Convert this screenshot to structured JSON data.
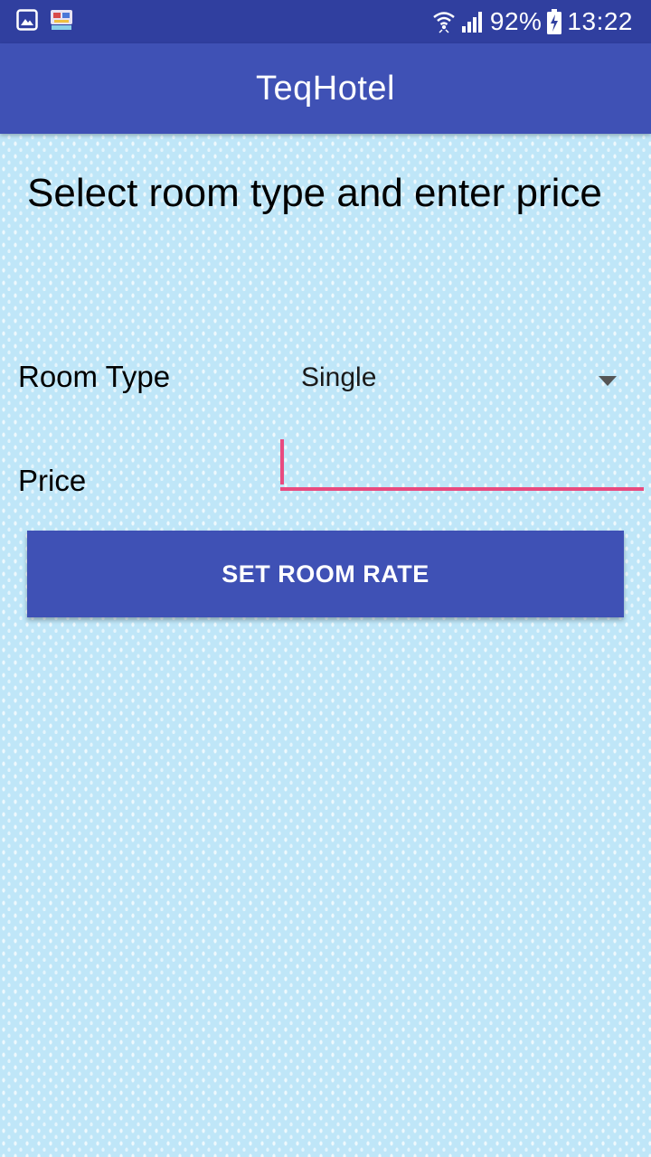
{
  "status_bar": {
    "left_icons": [
      "gallery-icon",
      "app-notification-icon"
    ],
    "right_icons": [
      "wifi-icon",
      "cellular-signal-icon",
      "battery-charging-icon"
    ],
    "battery_percent": "92%",
    "time": "13:22"
  },
  "app_bar": {
    "title": "TeqHotel",
    "background": "#3f51b5"
  },
  "main": {
    "heading": "Select room type and enter price",
    "room_type": {
      "label": "Room Type",
      "selected": "Single",
      "dropdown_icon": "dropdown-arrow-icon"
    },
    "price": {
      "label": "Price",
      "value": "",
      "accent": "#e84a7f"
    },
    "submit_label": "SET ROOM RATE"
  },
  "colors": {
    "primary": "#3f51b5",
    "primary_dark": "#303f9f",
    "accent": "#e84a7f",
    "background": "#bfe6f8"
  }
}
